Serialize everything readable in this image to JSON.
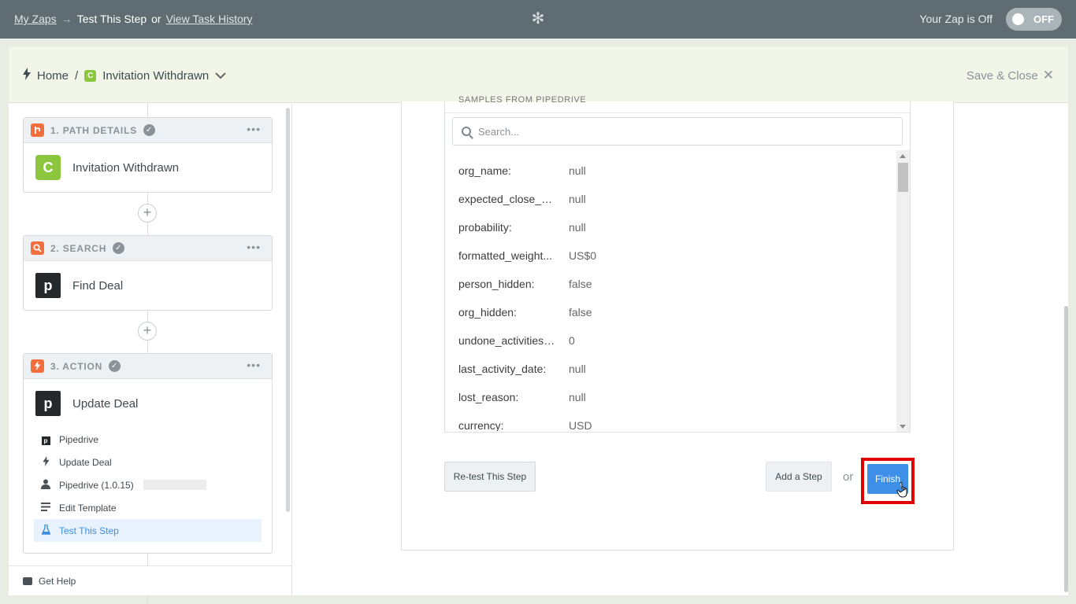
{
  "topbar": {
    "my_zaps": "My Zaps",
    "arrow": "→",
    "current": "Test This Step",
    "or": "or",
    "task_history": "View Task History",
    "zap_status": "Your Zap is Off",
    "toggle_label": "OFF",
    "spinner_icon": "asterisk-icon"
  },
  "header": {
    "home": "Home",
    "separator": "/",
    "app_letter": "C",
    "zap_name": "Invitation Withdrawn",
    "save_close": "Save & Close"
  },
  "steps": [
    {
      "number_label": "1. PATH DETAILS",
      "icon": "path-icon",
      "app_letter": "C",
      "title": "Invitation Withdrawn",
      "menu": "•••"
    },
    {
      "number_label": "2. SEARCH",
      "icon": "search-icon",
      "app_letter": "p",
      "title": "Find Deal",
      "menu": "•••"
    },
    {
      "number_label": "3. ACTION",
      "icon": "bolt-icon",
      "app_letter": "p",
      "title": "Update Deal",
      "menu": "•••",
      "subitems": [
        {
          "label": "Pipedrive",
          "icon": "pipedrive-icon"
        },
        {
          "label": "Update Deal",
          "icon": "bolt-icon"
        },
        {
          "label": "Pipedrive (1.0.15)",
          "icon": "person-icon"
        },
        {
          "label": "Edit Template",
          "icon": "list-icon"
        },
        {
          "label": "Test This Step",
          "icon": "flask-icon",
          "active": true
        }
      ]
    }
  ],
  "sidebar": {
    "get_help": "Get Help"
  },
  "samples": {
    "cut_label": "SAMPLES FROM PIPEDRIVE",
    "search_placeholder": "Search...",
    "rows": [
      {
        "key": "org_name:",
        "value": "null"
      },
      {
        "key": "expected_close_da...",
        "value": "null"
      },
      {
        "key": "probability:",
        "value": "null"
      },
      {
        "key": "formatted_weight...",
        "value": "US$0"
      },
      {
        "key": "person_hidden:",
        "value": "false"
      },
      {
        "key": "org_hidden:",
        "value": "false"
      },
      {
        "key": "undone_activities_...",
        "value": "0"
      },
      {
        "key": "last_activity_date:",
        "value": "null"
      },
      {
        "key": "lost_reason:",
        "value": "null"
      },
      {
        "key": "currency:",
        "value": "USD"
      }
    ]
  },
  "actions": {
    "retest": "Re-test This Step",
    "add_step": "Add a Step",
    "or": "or",
    "finish": "Finish"
  },
  "colors": {
    "topbar": "#5f6c72",
    "header": "#f1f6e8",
    "accent_blue": "#3d8fe8",
    "highlight_red": "#e00000",
    "app_green": "#8cc63f",
    "step_orange": "#f26f3d"
  }
}
